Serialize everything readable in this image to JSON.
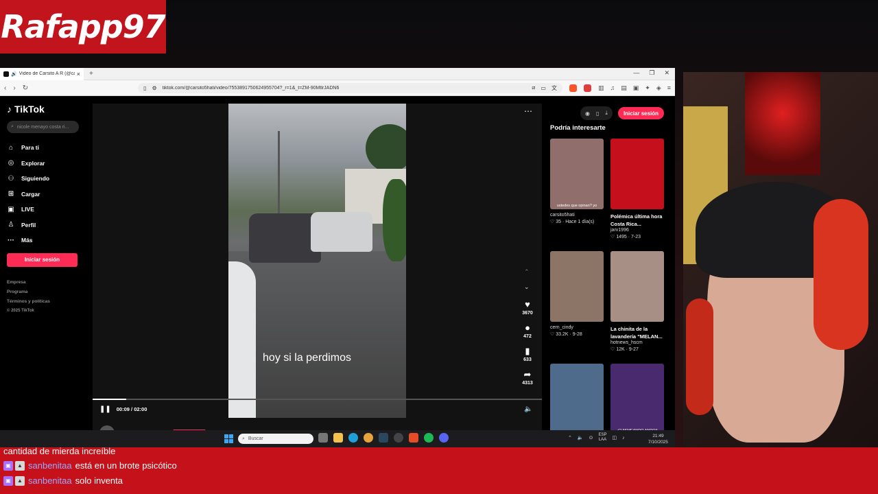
{
  "overlay": {
    "logo_text": "Rafapp97"
  },
  "browser": {
    "tab_title": "Video de Carsito A R (@carsit...",
    "url": "tiktok.com/@carsito5hati/video/7553891750624955704?_r=1&_t=ZM-90MtlrJADN6"
  },
  "tiktok": {
    "brand": "TikTok",
    "search_placeholder": "nicole menayo costa ri...",
    "nav": [
      {
        "label": "Para ti",
        "icon": "home-icon"
      },
      {
        "label": "Explorar",
        "icon": "compass-icon"
      },
      {
        "label": "Siguiendo",
        "icon": "following-icon"
      },
      {
        "label": "Cargar",
        "icon": "upload-icon"
      },
      {
        "label": "LIVE",
        "icon": "live-icon"
      },
      {
        "label": "Perfil",
        "icon": "profile-icon"
      },
      {
        "label": "Más",
        "icon": "more-icon"
      }
    ],
    "login_label": "Iniciar sesión",
    "footer": [
      "Empresa",
      "Programa",
      "Términos y políticas",
      "© 2025 TikTok"
    ],
    "video": {
      "caption": "hoy si la perdimos",
      "time": "00:09 / 02:00",
      "progress": 0.075,
      "author": "carsito5hati",
      "actions": [
        {
          "icon": "heart-icon",
          "count": "3670"
        },
        {
          "icon": "comment-icon",
          "count": "472"
        },
        {
          "icon": "bookmark-icon",
          "count": "633"
        },
        {
          "icon": "share-icon",
          "count": "4313"
        }
      ]
    },
    "right": {
      "login_label": "Iniciar sesión",
      "suggest_title": "Podría interesarte",
      "cards": [
        {
          "title": "",
          "user": "carsito5hati",
          "meta": "♡ 35 · Hace 1 día(s)",
          "thumb_caption": "ustedes que opinan? yo",
          "color": "#8f6e6b"
        },
        {
          "title": "Polémica última hora Costa Rica...",
          "user": "jarv1996",
          "meta": "♡ 1495 · 7-23",
          "thumb_caption": "",
          "color": "#c50f1d"
        },
        {
          "title": "",
          "user": "cern_cindy",
          "meta": "♡ 33.2K · 9-28",
          "thumb_caption": "",
          "color": "#8c7467"
        },
        {
          "title": "La chinita de la lavandería \"MELAN...",
          "user": "hotnews_hscm",
          "meta": "♡ 12K · 9-27",
          "thumb_caption": "",
          "color": "#a88f86"
        },
        {
          "title": "",
          "user": "",
          "meta": "",
          "thumb_caption": "",
          "color": "#4f6b8c"
        },
        {
          "title": "",
          "user": "",
          "meta": "",
          "thumb_caption": "¡CHISMEANDO ANDO!!",
          "color": "#4a2a6e"
        }
      ]
    }
  },
  "taskbar": {
    "search_placeholder": "Buscar",
    "lang_top": "ESP",
    "lang_bottom": "LAA",
    "time": "21:49",
    "date": "7/10/2025"
  },
  "chat": [
    {
      "user": "",
      "text": "cantidad de mierda increíble"
    },
    {
      "user": "sanbenitaa",
      "text": "está en un brote psicótico"
    },
    {
      "user": "sanbenitaa",
      "text": "solo inventa"
    }
  ]
}
